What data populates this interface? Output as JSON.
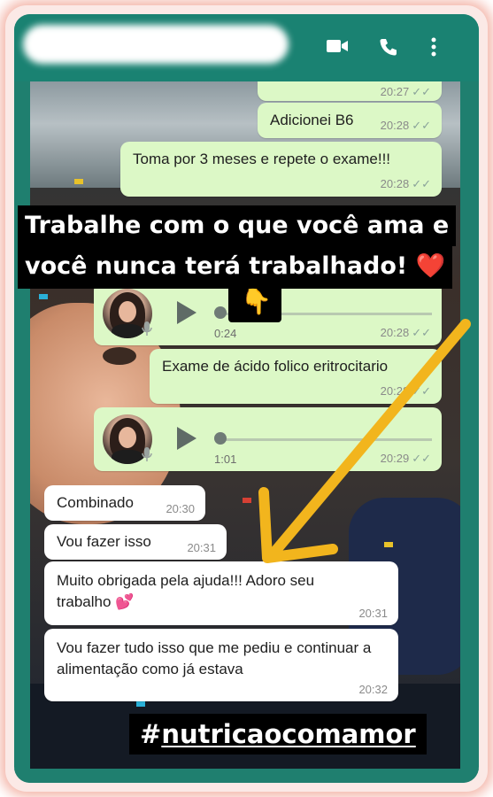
{
  "header": {
    "icons": [
      "video-call-icon",
      "phone-icon",
      "more-options-icon"
    ]
  },
  "messages": {
    "m1_time": "20:27",
    "m2_text": "Adicionei B6",
    "m2_time": "20:28",
    "m3_text": "Toma por 3 meses e repete o exame!!!",
    "m3_time": "20:28",
    "audio1_duration": "0:24",
    "audio1_time": "20:28",
    "m5_text": "Exame de ácido folico eritrocitario",
    "m5_time": "20:28",
    "audio2_duration": "1:01",
    "audio2_time": "20:29",
    "m7_text": "Combinado",
    "m7_time": "20:30",
    "m8_text": "Vou fazer isso",
    "m8_time": "20:31",
    "m9_text": "Muito obrigada pela ajuda!!! Adoro seu trabalho 💕",
    "m9_time": "20:31",
    "m10_text": "Vou fazer tudo isso que me pediu e continuar a alimentação como já estava",
    "m10_time": "20:32"
  },
  "overlay": {
    "line1": "Trabalhe com o que você ama e",
    "line2": "você nunca terá trabalhado! ❤️",
    "pointer_emoji": "👇",
    "hashtag_hash": "#",
    "hashtag_word": "nutricaocomamor"
  },
  "colors": {
    "header": "#1a8272",
    "outgoing_bubble": "#dcf8c6",
    "incoming_bubble": "#ffffff",
    "arrow": "#f2b51d"
  }
}
